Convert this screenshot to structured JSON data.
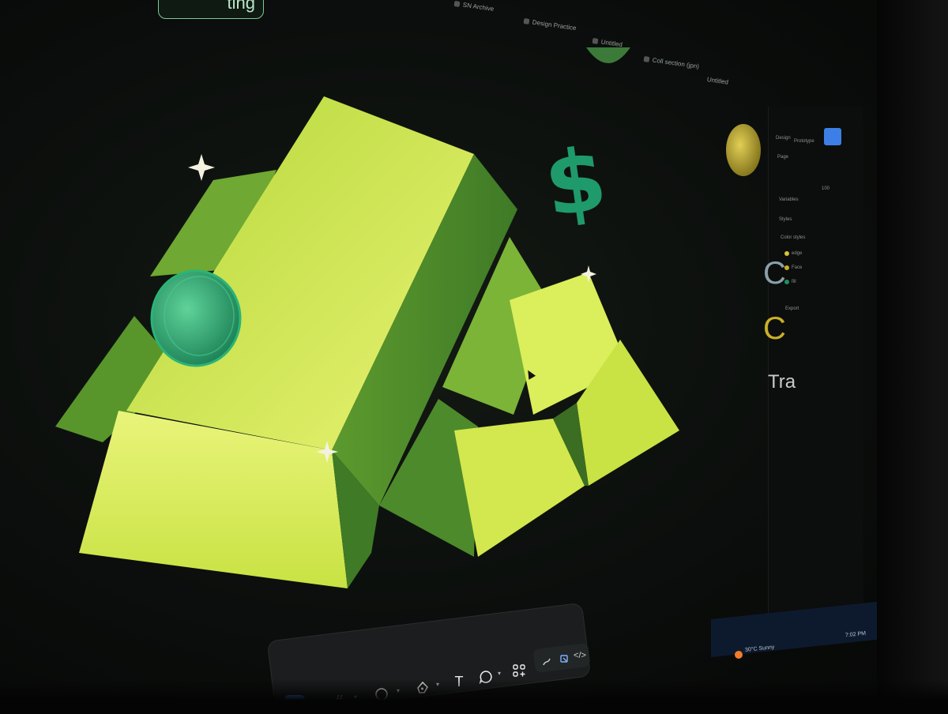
{
  "tabs": {
    "pill_label": "ting",
    "items": [
      {
        "label": "SN Archive"
      },
      {
        "label": "Design Practice"
      },
      {
        "label": "Untitled"
      },
      {
        "label": "Coll section (jpn)"
      },
      {
        "label": "Untitled"
      }
    ]
  },
  "panel": {
    "design_tab": "Design",
    "prototype_tab": "Prototype",
    "page_label": "Page",
    "variables_label": "Variables",
    "styles_label": "Styles",
    "color_styles_label": "Color styles",
    "colors": [
      {
        "name": "edge",
        "hex": "#d6c43a"
      },
      {
        "name": "Face",
        "hex": "#c9b027"
      },
      {
        "name": "fill",
        "hex": "#1f8f5f"
      }
    ],
    "export_label": "Export",
    "percent": "100",
    "heading_fragment": "Tra"
  },
  "taskbar": {
    "weather": "30°C  Sunny",
    "time": "7:02 PM"
  },
  "toolbar": {
    "tools": [
      {
        "name": "move-tool",
        "icon": "cursor-icon",
        "active": true
      },
      {
        "name": "frame-tool",
        "icon": "hash-icon",
        "active": false
      },
      {
        "name": "shape-tool",
        "icon": "circle-icon",
        "active": false
      },
      {
        "name": "pen-tool",
        "icon": "pen-icon",
        "active": false
      },
      {
        "name": "text-tool",
        "icon": "text-icon",
        "glyph": "T",
        "active": false
      },
      {
        "name": "comment-tool",
        "icon": "comment-icon",
        "active": false
      },
      {
        "name": "actions-tool",
        "icon": "grid-plus-icon",
        "active": false
      }
    ],
    "mode_tools": [
      {
        "name": "draw-mode",
        "icon": "draw-icon"
      },
      {
        "name": "design-mode",
        "icon": "design-icon"
      },
      {
        "name": "dev-mode",
        "icon": "code-icon",
        "glyph": "</>"
      }
    ]
  },
  "illustration": {
    "symbol": "$",
    "colors": {
      "gold_light": "#e6f06a",
      "gold_mid": "#b8d635",
      "gold_dark": "#4f8f2c",
      "green": "#1f9a6a"
    }
  }
}
